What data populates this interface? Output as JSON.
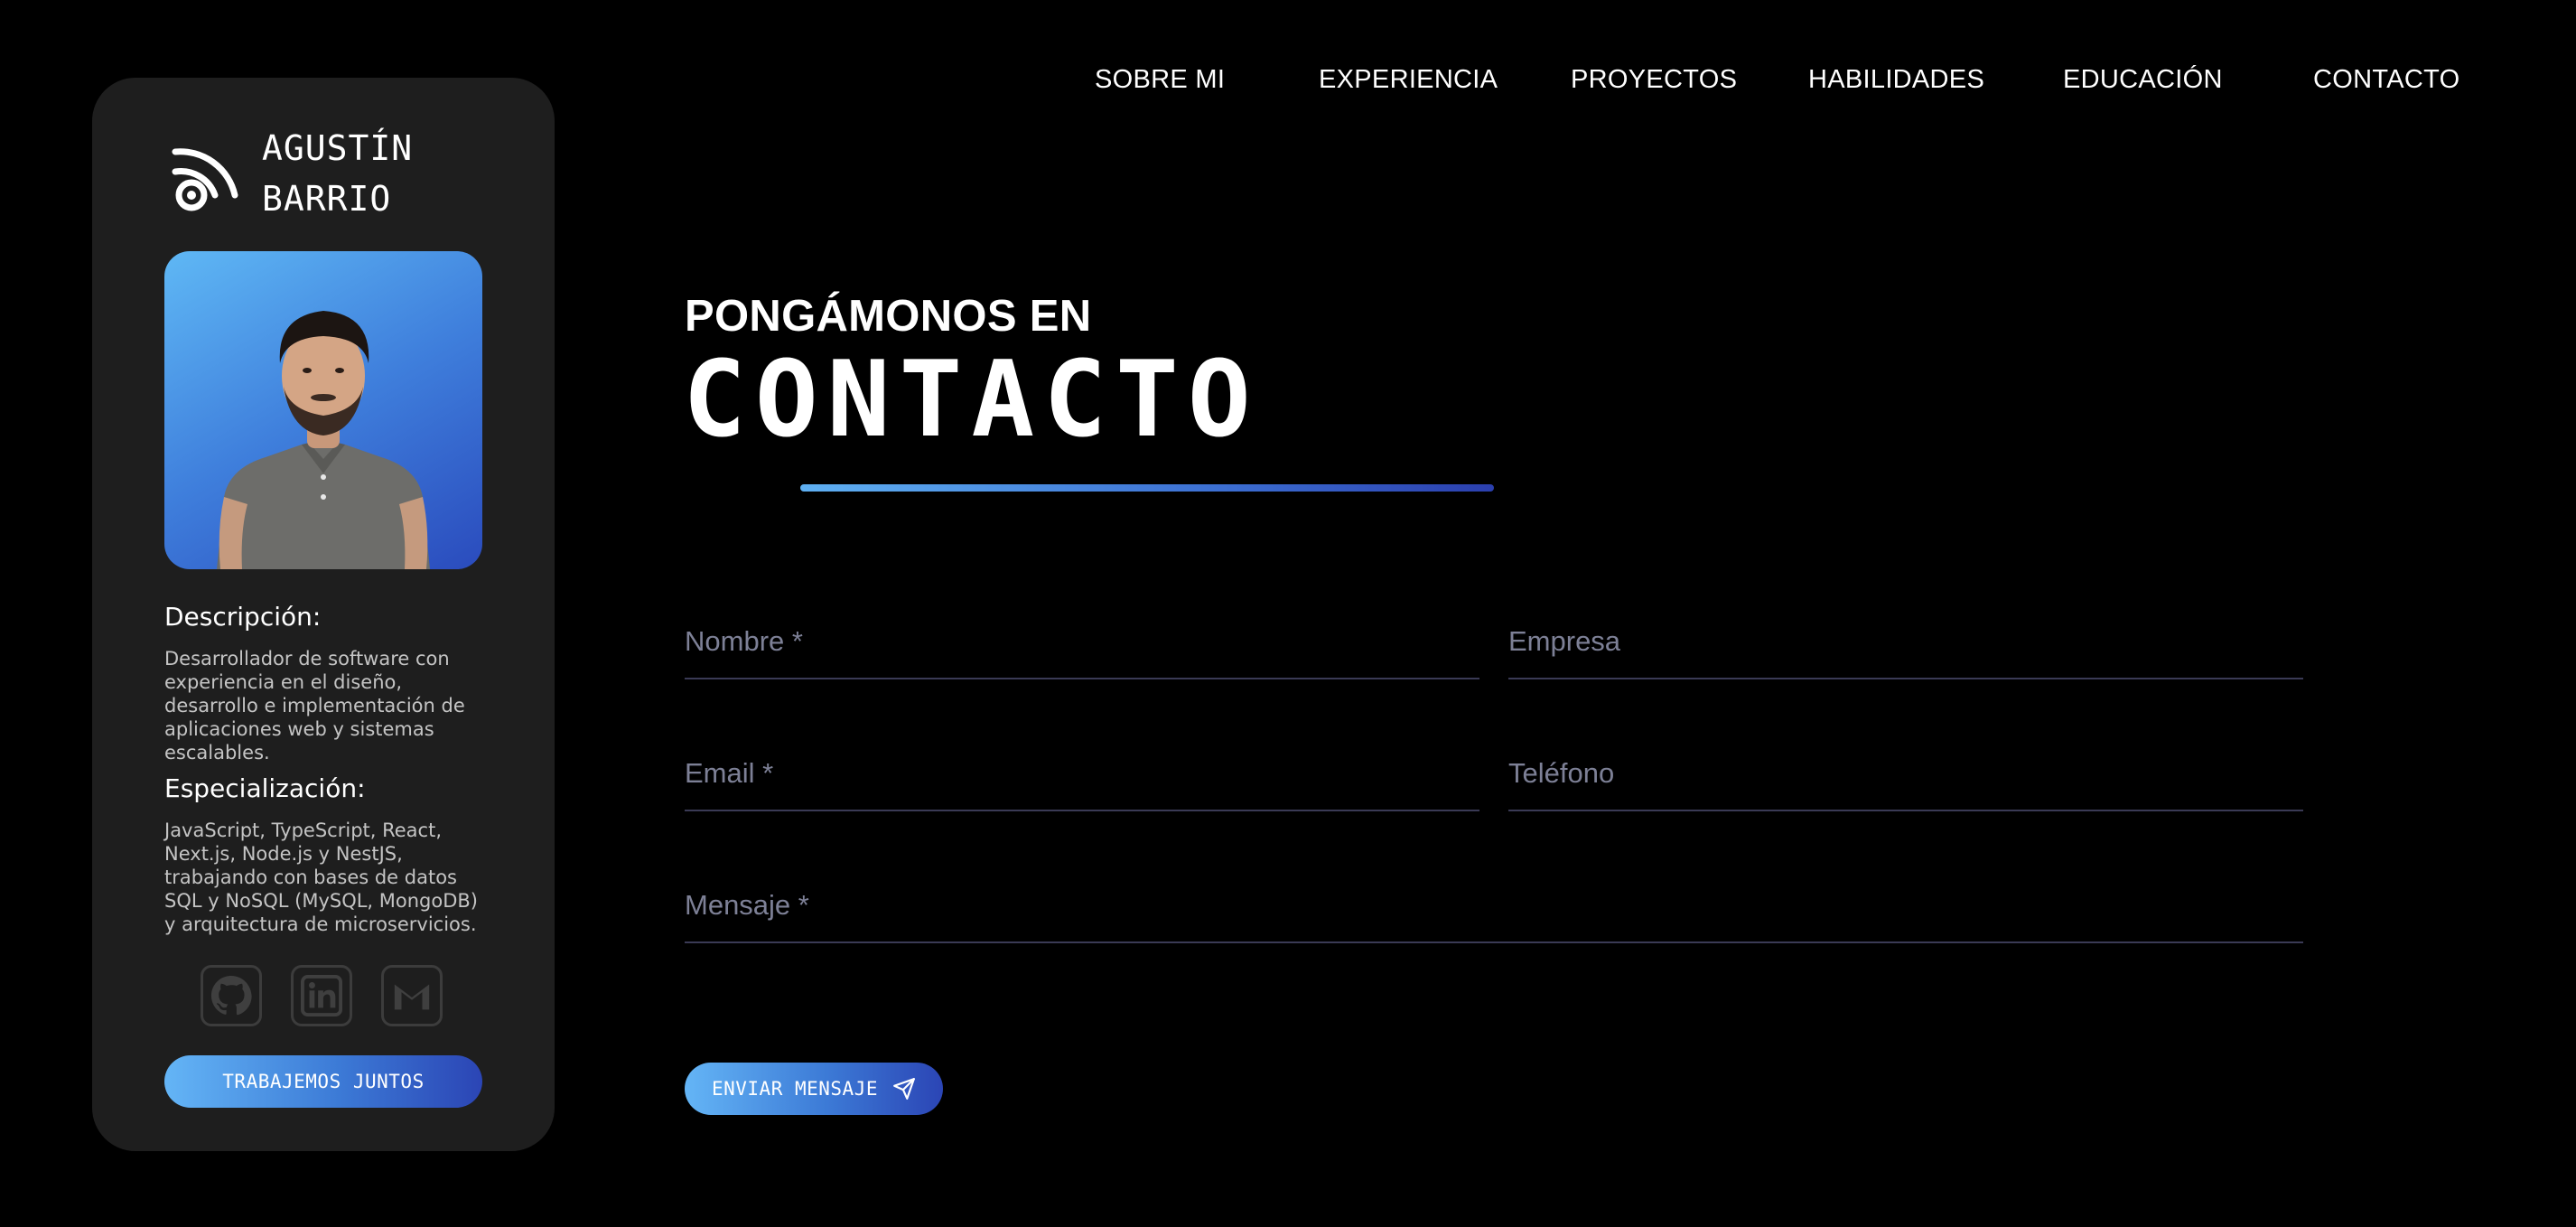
{
  "nav": {
    "items": [
      {
        "label": "SOBRE MI"
      },
      {
        "label": "EXPERIENCIA"
      },
      {
        "label": "PROYECTOS"
      },
      {
        "label": "HABILIDADES"
      },
      {
        "label": "EDUCACIÓN"
      },
      {
        "label": "CONTACTO"
      }
    ]
  },
  "profile": {
    "brand_icon": "rss-signal-icon",
    "name_line1": "AGUSTÍN",
    "name_line2": "BARRIO",
    "description_title": "Descripción:",
    "description_text": "Desarrollador de software con experiencia en el diseño, desarrollo e implementación de aplicaciones web y sistemas escalables.",
    "specialization_title": "Especialización:",
    "specialization_text": "JavaScript, TypeScript, React, Next.js, Node.js y NestJS, trabajando con bases de datos SQL y NoSQL (MySQL, MongoDB) y arquitectura de microservicios.",
    "socials": [
      {
        "icon": "github-icon"
      },
      {
        "icon": "linkedin-icon"
      },
      {
        "icon": "gmail-icon"
      }
    ],
    "cta_label": "TRABAJEMOS JUNTOS"
  },
  "contact": {
    "kicker": "PONGÁMONOS EN",
    "headline": "CONTACTO",
    "fields": {
      "name": {
        "placeholder": "Nombre *",
        "value": ""
      },
      "company": {
        "placeholder": "Empresa",
        "value": ""
      },
      "email": {
        "placeholder": "Email *",
        "value": ""
      },
      "phone": {
        "placeholder": "Teléfono",
        "value": ""
      },
      "message": {
        "placeholder": "Mensaje *",
        "value": ""
      }
    },
    "submit_label": "ENVIAR MENSAJE",
    "submit_icon": "send-icon"
  },
  "colors": {
    "background": "#000000",
    "card": "#1e1e1e",
    "accent_start": "#64b5f6",
    "accent_end": "#2b45b5",
    "placeholder": "#7d8096"
  }
}
